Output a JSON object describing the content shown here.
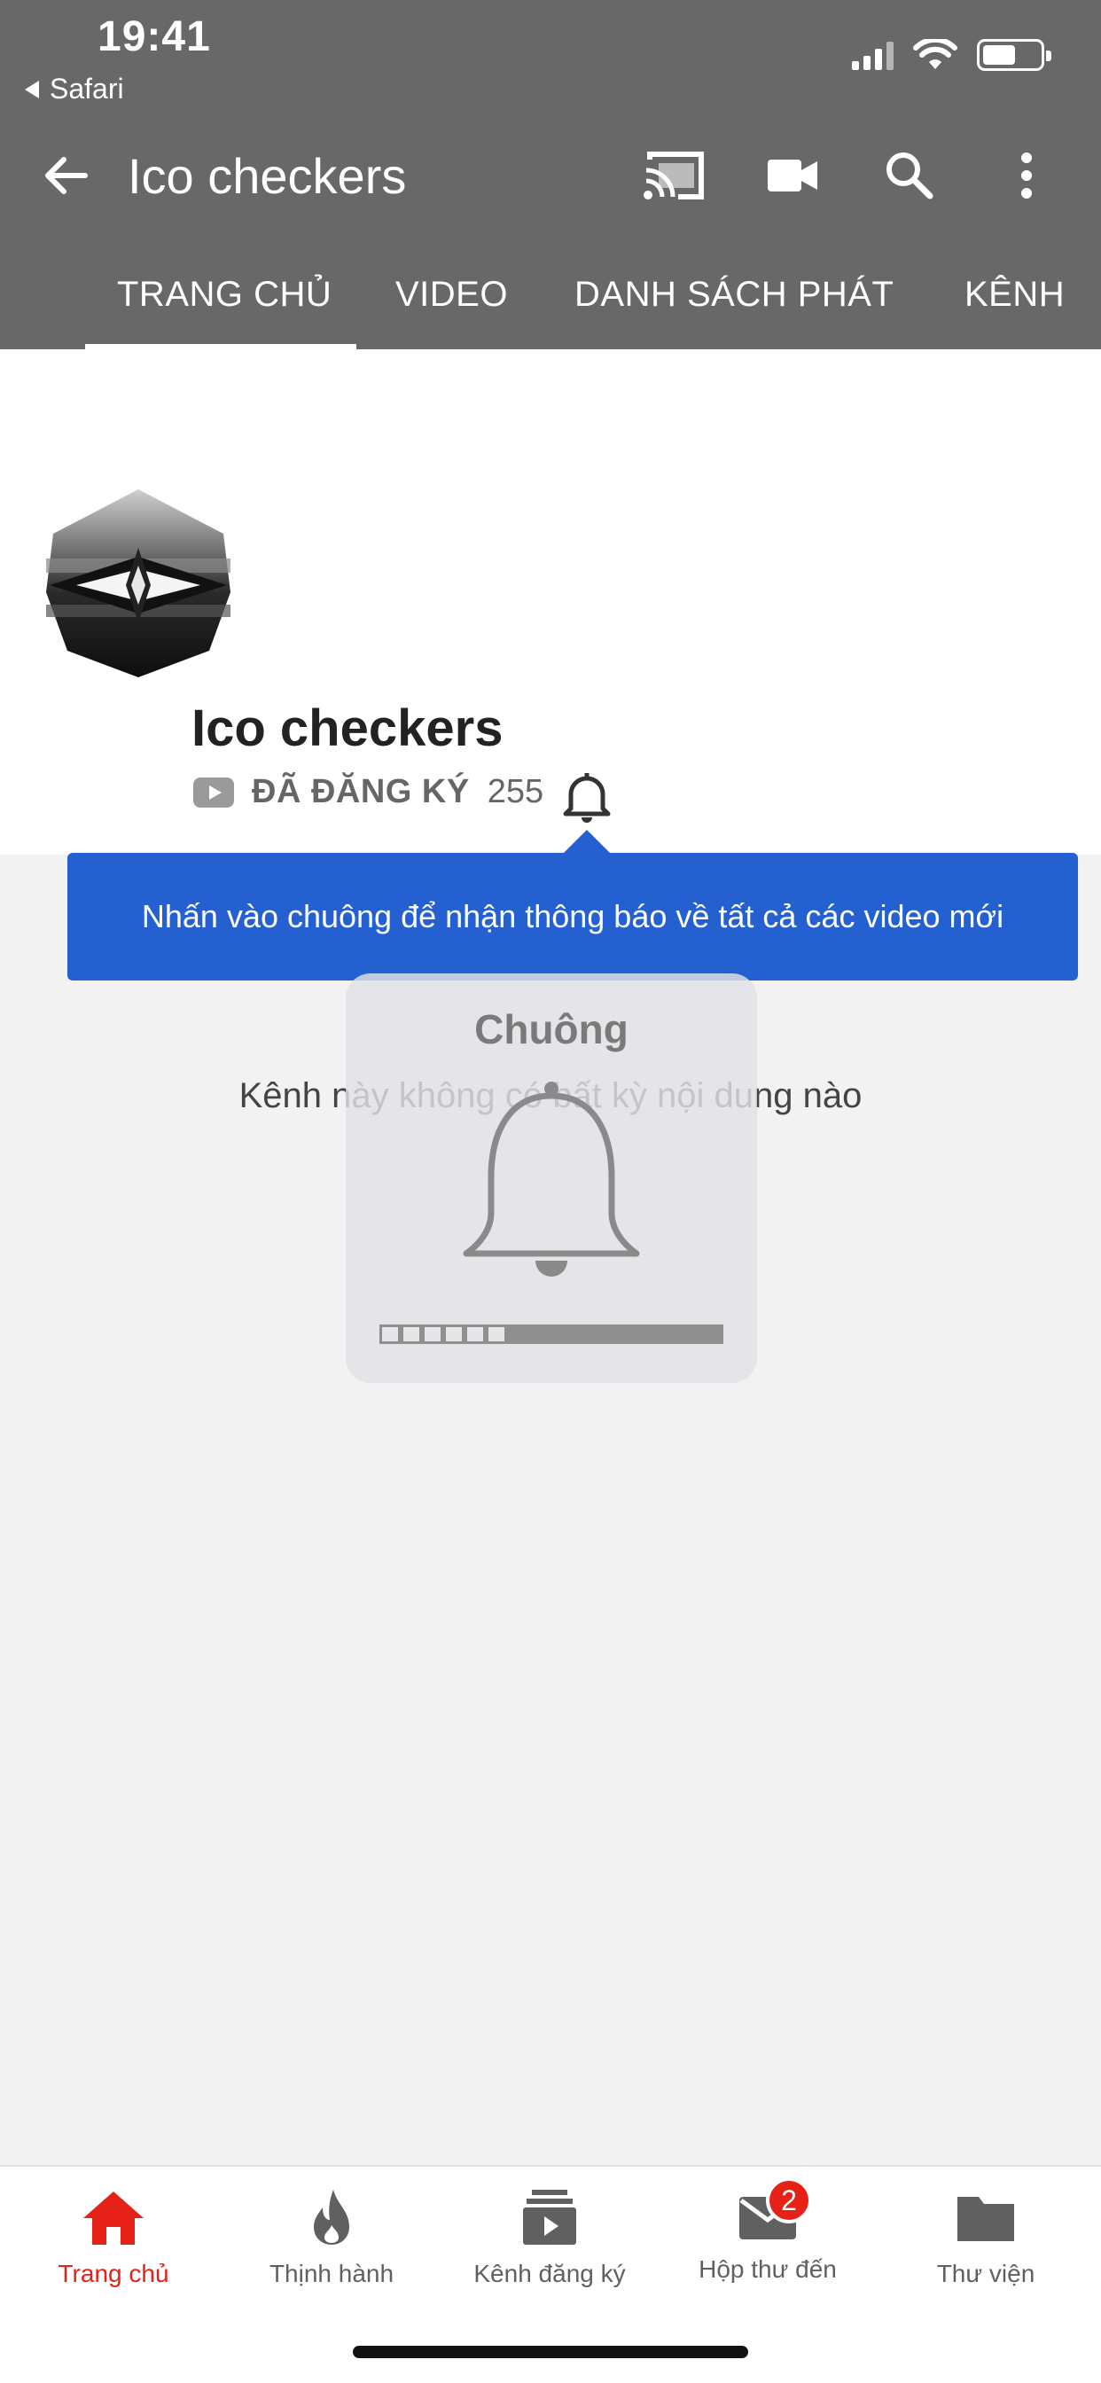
{
  "status_bar": {
    "time": "19:41",
    "back_app": "Safari"
  },
  "app_bar": {
    "title": "Ico checkers"
  },
  "tabs": [
    {
      "label": "TRANG CHỦ"
    },
    {
      "label": "VIDEO"
    },
    {
      "label": "DANH SÁCH PHÁT"
    },
    {
      "label": "KÊNH"
    }
  ],
  "channel": {
    "name": "Ico checkers",
    "subscribed_label": "ĐÃ ĐĂNG KÝ",
    "subscriber_count": "255"
  },
  "tooltip": {
    "text": "Nhấn vào chuông để nhận thông báo về tất cả các video mới"
  },
  "empty_message": "Kênh này không có bất kỳ nội dung nào",
  "hud": {
    "title": "Chuông",
    "level_filled_segments": 6,
    "level_total_segments": 16
  },
  "bottom_nav": [
    {
      "label": "Trang chủ"
    },
    {
      "label": "Thịnh hành"
    },
    {
      "label": "Kênh đăng ký"
    },
    {
      "label": "Hộp thư đến",
      "badge": "2"
    },
    {
      "label": "Thư viện"
    }
  ],
  "colors": {
    "accent_red": "#e62117",
    "tooltip_blue": "#2460d0",
    "header_dim": "#686868"
  }
}
